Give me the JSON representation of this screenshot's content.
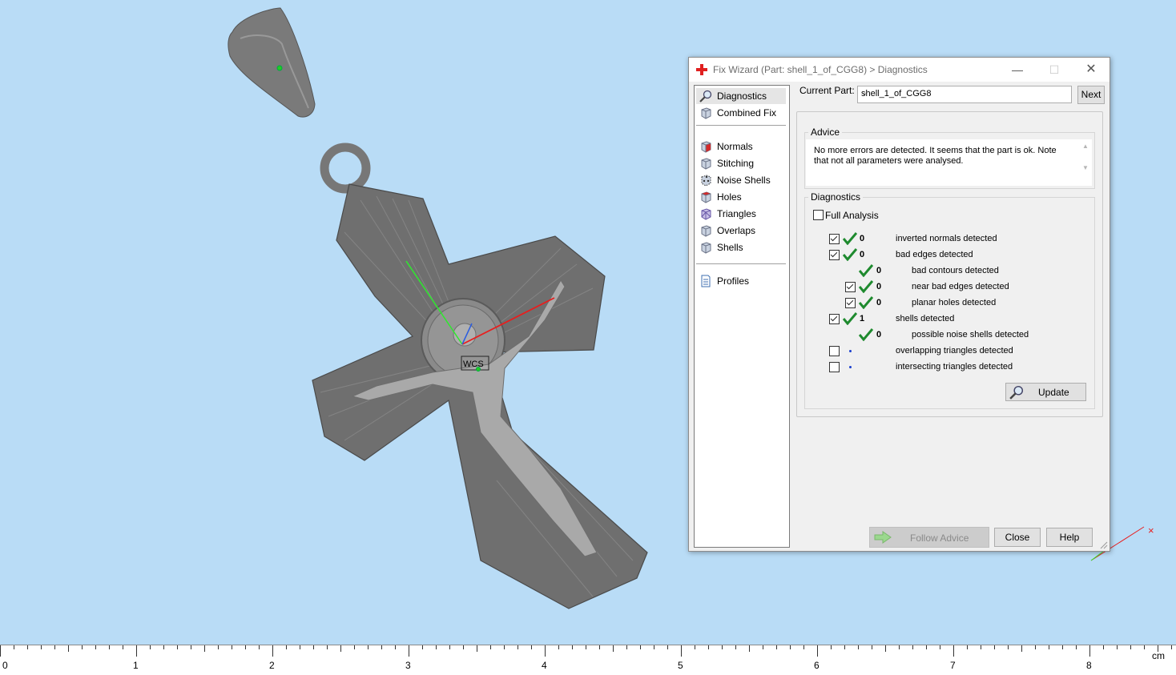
{
  "window": {
    "title": "Fix Wizard (Part: shell_1_of_CGG8) > Diagnostics",
    "controls": {
      "minimize": "—",
      "maximize": "☐",
      "close": "✕"
    }
  },
  "nav": {
    "items": [
      {
        "label": "Diagnostics",
        "icon": "magnifier-icon",
        "selected": true
      },
      {
        "label": "Combined Fix",
        "icon": "cube-icon"
      },
      {
        "label": "Normals",
        "icon": "cube-red-face-icon"
      },
      {
        "label": "Stitching",
        "icon": "cube-icon"
      },
      {
        "label": "Noise Shells",
        "icon": "dotted-cube-icon"
      },
      {
        "label": "Holes",
        "icon": "cube-red-face-icon"
      },
      {
        "label": "Triangles",
        "icon": "cube-purple-icon"
      },
      {
        "label": "Overlaps",
        "icon": "cube-icon"
      },
      {
        "label": "Shells",
        "icon": "cube-icon"
      },
      {
        "label": "Profiles",
        "icon": "document-icon"
      }
    ]
  },
  "current_part": {
    "label": "Current Part:",
    "value": "shell_1_of_CGG8",
    "next_label": "Next"
  },
  "advice": {
    "title": "Advice",
    "text": "No more errors are detected. It seems that the part is ok. Note that not all parameters were analysed."
  },
  "diagnostics": {
    "title": "Diagnostics",
    "full_analysis_label": "Full Analysis",
    "full_analysis_checked": false,
    "rows": [
      {
        "checkbox": true,
        "checked": true,
        "status": "ok",
        "count": "0",
        "label": "inverted normals detected",
        "indent": 0
      },
      {
        "checkbox": true,
        "checked": true,
        "status": "ok",
        "count": "0",
        "label": "bad edges detected",
        "indent": 0
      },
      {
        "checkbox": false,
        "checked": false,
        "status": "ok",
        "count": "0",
        "label": "bad contours detected",
        "indent": 1
      },
      {
        "checkbox": true,
        "checked": true,
        "status": "ok",
        "count": "0",
        "label": "near bad edges detected",
        "indent": 1
      },
      {
        "checkbox": true,
        "checked": true,
        "status": "ok",
        "count": "0",
        "label": "planar holes detected",
        "indent": 1
      },
      {
        "checkbox": true,
        "checked": true,
        "status": "ok",
        "count": "1",
        "label": "shells detected",
        "indent": 0
      },
      {
        "checkbox": false,
        "checked": false,
        "status": "ok",
        "count": "0",
        "label": "possible noise shells detected",
        "indent": 1
      },
      {
        "checkbox": true,
        "checked": false,
        "status": "pending",
        "count": "",
        "label": "overlapping triangles detected",
        "indent": 0
      },
      {
        "checkbox": true,
        "checked": false,
        "status": "pending",
        "count": "",
        "label": "intersecting triangles detected",
        "indent": 0
      }
    ],
    "update_label": "Update"
  },
  "footer": {
    "follow_advice_label": "Follow Advice",
    "close_label": "Close",
    "help_label": "Help"
  },
  "viewport": {
    "wcs_label": "WCS"
  },
  "ruler": {
    "labels": [
      "0",
      "1",
      "2",
      "3",
      "4",
      "5",
      "6",
      "7",
      "8"
    ],
    "unit": "cm"
  },
  "colors": {
    "viewport_bg": "#b9dcf6",
    "check_green": "#1e8a2e",
    "model_gray": "#6f6f6f"
  }
}
